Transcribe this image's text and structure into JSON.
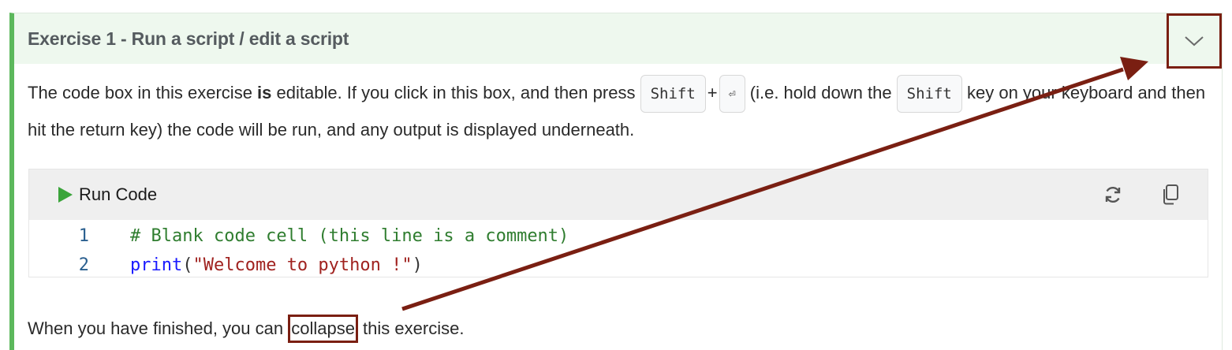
{
  "exercise": {
    "title": "Exercise 1 - Run a script / edit a script",
    "collapse_icon": "chevron-down-icon"
  },
  "instructions": {
    "part1": "The code box in this exercise ",
    "bold": "is",
    "part2": " editable. If you click in this box, and then press ",
    "key_shift": "Shift",
    "plus": "+",
    "key_return": "⏎",
    "part3": " (i.e. hold down the ",
    "part4": " key on your keyboard and then hit the return key) the code will be run, and any output is displayed underneath."
  },
  "code_cell": {
    "run_label": "Run Code",
    "reset_icon": "refresh-icon",
    "copy_icon": "copy-icon",
    "lines": [
      {
        "num": "1",
        "comment": "# Blank code cell (this line is a comment)"
      },
      {
        "num": "2",
        "func": "print",
        "open": "(",
        "string": "\"Welcome to python !\"",
        "close": ")"
      }
    ]
  },
  "footer_text": {
    "before": "When you have finished, you can ",
    "link": "collapse",
    "after": " this exercise."
  },
  "colors": {
    "accent_green": "#5cb85c",
    "annotation_red": "#7a1f12",
    "header_bg": "#eef8ee"
  }
}
